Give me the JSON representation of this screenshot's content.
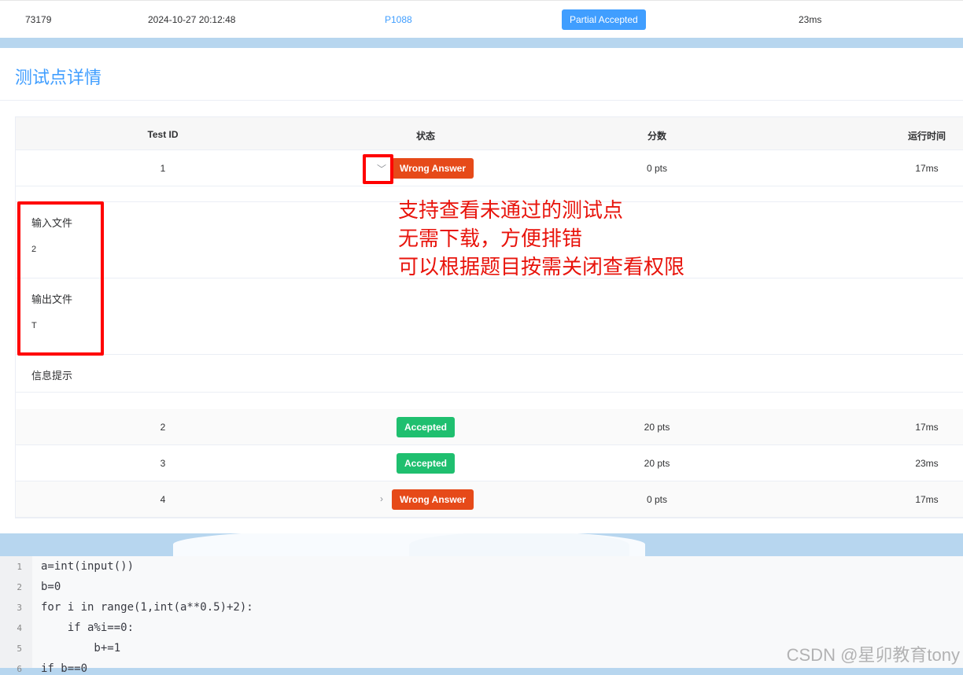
{
  "submission": {
    "id": "73179",
    "time": "2024-10-27 20:12:48",
    "problem": "P1088",
    "status": "Partial Accepted",
    "runtime": "23ms"
  },
  "section_title": "测试点详情",
  "table": {
    "headers": [
      "Test ID",
      "状态",
      "分数",
      "运行时间"
    ],
    "rows": [
      {
        "id": "1",
        "status": "Wrong Answer",
        "score": "0 pts",
        "time": "17ms",
        "expanded": true
      },
      {
        "id": "2",
        "status": "Accepted",
        "score": "20 pts",
        "time": "17ms"
      },
      {
        "id": "3",
        "status": "Accepted",
        "score": "20 pts",
        "time": "23ms"
      },
      {
        "id": "4",
        "status": "Wrong Answer",
        "score": "0 pts",
        "time": "17ms",
        "expanded": false
      }
    ]
  },
  "detail": {
    "input_label": "输入文件",
    "input_value": "2",
    "output_label": "输出文件",
    "output_value": "T",
    "info_label": "信息提示"
  },
  "annotation": {
    "line1": "支持查看未通过的测试点",
    "line2": "无需下载，方便排错",
    "line3": "可以根据题目按需关闭查看权限"
  },
  "code": {
    "line_numbers": [
      "1",
      "2",
      "3",
      "4",
      "5",
      "6"
    ],
    "lines": [
      "a=int(input())",
      "b=0",
      "for i in range(1,int(a**0.5)+2):",
      "    if a%i==0:",
      "        b+=1",
      "if b==0"
    ]
  },
  "watermark": "CSDN @星卯教育tony",
  "colors": {
    "primary": "#409eff",
    "wrong_answer": "#e64a19",
    "accepted": "#1fbf6f",
    "highlight": "#ff0000",
    "annotation": "#e8140c"
  }
}
